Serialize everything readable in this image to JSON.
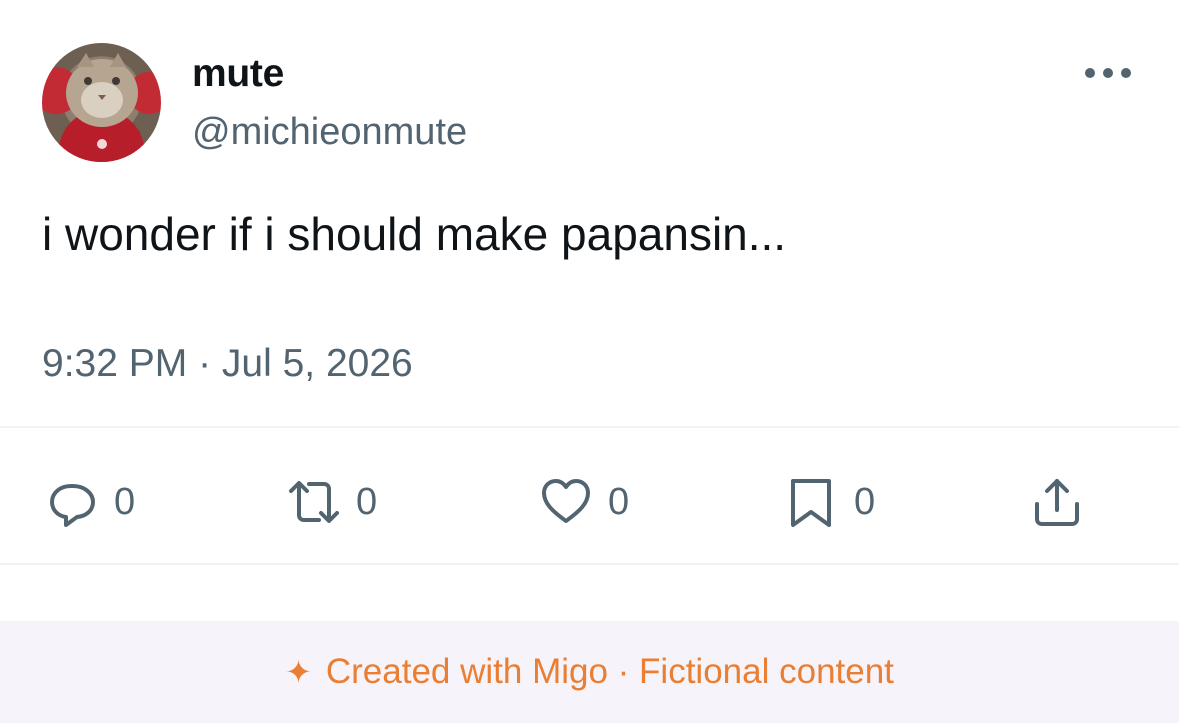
{
  "user": {
    "display_name": "mute",
    "handle": "@michieonmute",
    "avatar_icon": "cat-avatar"
  },
  "tweet": {
    "text": "i wonder if i should make papansin...",
    "timestamp": "9:32 PM · Jul 5, 2026"
  },
  "actions": {
    "reply": {
      "icon": "reply-icon",
      "count": "0"
    },
    "retweet": {
      "icon": "retweet-icon",
      "count": "0"
    },
    "like": {
      "icon": "heart-icon",
      "count": "0"
    },
    "bookmark": {
      "icon": "bookmark-icon",
      "count": "0"
    },
    "share": {
      "icon": "share-icon"
    }
  },
  "footer": {
    "icon": "sparkle-icon",
    "text": "Created with Migo · Fictional content"
  },
  "colors": {
    "text": "#0f1419",
    "muted": "#536471",
    "divider": "#eff3f4",
    "footer_bg": "#f6f3fa",
    "footer_text": "#ea7e33"
  }
}
